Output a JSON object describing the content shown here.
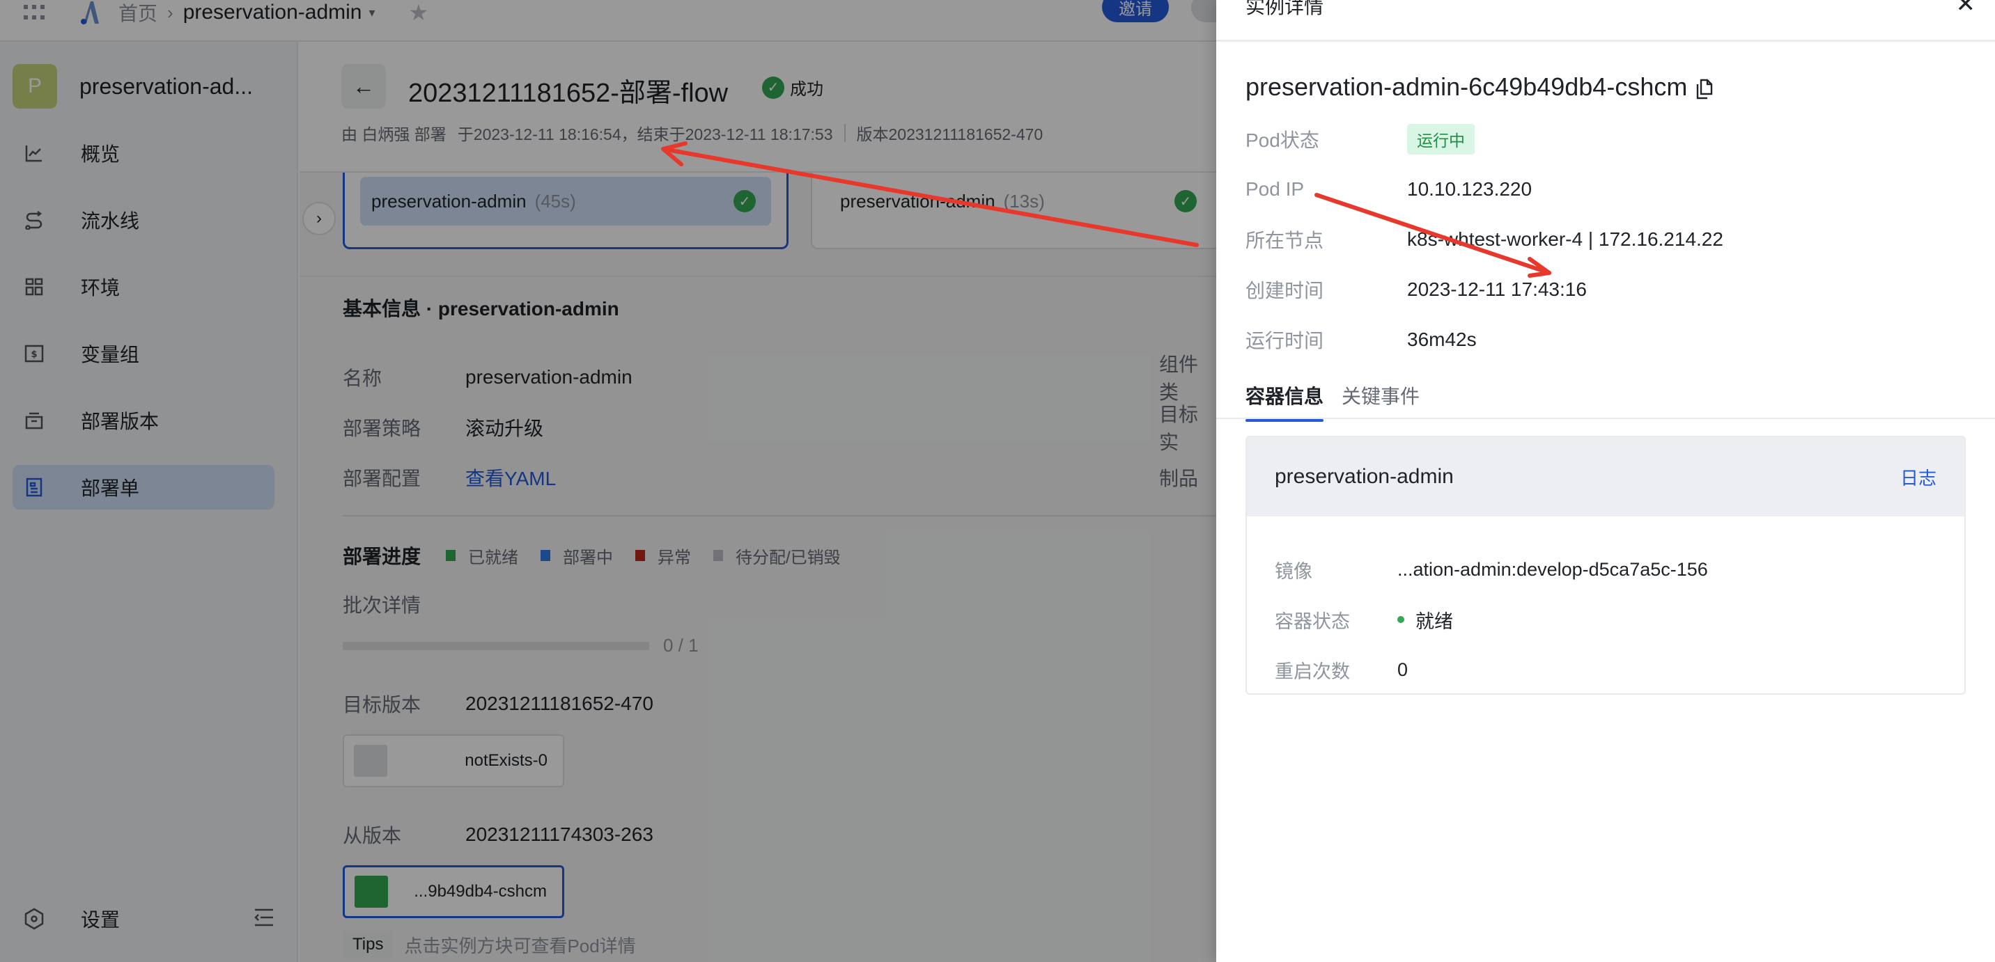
{
  "topbar": {
    "apps_icon": "grid-icon",
    "logo_icon": "logo-a-icon",
    "breadcrumb_home": "首页",
    "breadcrumb_sep": "›",
    "breadcrumb_current": "preservation-admin",
    "caret": "▾",
    "star": "★",
    "invite_label": "邀请"
  },
  "sidebar": {
    "project_initial": "P",
    "project_name": "preservation-ad...",
    "items": [
      {
        "label": "概览",
        "icon": "line-chart-icon"
      },
      {
        "label": "流水线",
        "icon": "pipeline-icon"
      },
      {
        "label": "环境",
        "icon": "grid-apps-icon"
      },
      {
        "label": "变量组",
        "icon": "dollar-box-icon"
      },
      {
        "label": "部署版本",
        "icon": "archive-icon"
      },
      {
        "label": "部署单",
        "icon": "document-icon",
        "active": true
      }
    ],
    "settings_label": "设置"
  },
  "header": {
    "back": "←",
    "title": "20231211181652-部署-flow",
    "status": "成功",
    "deployed_by": "由 白炳强 部署",
    "start": "于2023-12-11 18:16:54，结束于2023-12-11 18:17:53",
    "version": "版本20231211181652-470"
  },
  "stages": [
    {
      "name": "preservation-admin",
      "duration": "(45s)",
      "status": "success",
      "selected": true
    },
    {
      "name": "preservation-admin",
      "duration": "(13s)",
      "status": "success",
      "selected": false
    }
  ],
  "stage_toggle": "›",
  "basic_info": {
    "title": "基本信息 · preservation-admin",
    "rows": [
      {
        "label": "名称",
        "value": "preservation-admin",
        "right_label": "组件类"
      },
      {
        "label": "部署策略",
        "value": "滚动升级",
        "right_label": "目标实"
      },
      {
        "label": "部署配置",
        "value": "查看YAML",
        "right_label": "制品"
      }
    ]
  },
  "progress": {
    "title": "部署进度",
    "legend": [
      {
        "label": "已就绪",
        "color": "#34a853"
      },
      {
        "label": "部署中",
        "color": "#2f7ae5"
      },
      {
        "label": "异常",
        "color": "#c0281c"
      },
      {
        "label": "待分配/已销毁",
        "color": "#bbbfc4"
      }
    ],
    "batch_label": "批次详情",
    "batch_done": 0,
    "batch_total": 1,
    "batch_text": "0 / 1",
    "target_version_label": "目标版本",
    "target_version": "20231211181652-470",
    "target_instance": {
      "name": "notExists-0",
      "color": "#dee0e3"
    },
    "from_version_label": "从版本",
    "from_version": "20231211174303-263",
    "from_instance": {
      "name": "...9b49db4-cshcm",
      "color": "#34a853"
    },
    "tips_tag": "Tips",
    "tips_text": "点击实例方块可查看Pod详情"
  },
  "drawer": {
    "title": "实例详情",
    "close": "✕",
    "pod_name": "preservation-admin-6c49b49db4-cshcm",
    "fields": [
      {
        "label": "Pod状态",
        "value": "运行中",
        "type": "tag"
      },
      {
        "label": "Pod IP",
        "value": "10.10.123.220"
      },
      {
        "label": "所在节点",
        "value": "k8s-whtest-worker-4 | 172.16.214.22"
      },
      {
        "label": "创建时间",
        "value": "2023-12-11 17:43:16"
      },
      {
        "label": "运行时间",
        "value": "36m42s"
      }
    ],
    "tabs": [
      {
        "label": "容器信息",
        "active": true
      },
      {
        "label": "关键事件",
        "active": false
      }
    ],
    "container": {
      "name": "preservation-admin",
      "log_link": "日志",
      "rows": [
        {
          "label": "镜像",
          "value": "...ation-admin:develop-d5ca7a5c-156"
        },
        {
          "label": "容器状态",
          "value": "就绪",
          "dot_color": "#34a853"
        },
        {
          "label": "重启次数",
          "value": "0"
        }
      ]
    }
  },
  "colors": {
    "accent": "#245bdb",
    "success": "#34a853",
    "annotation_arrow": "#e8382b"
  }
}
